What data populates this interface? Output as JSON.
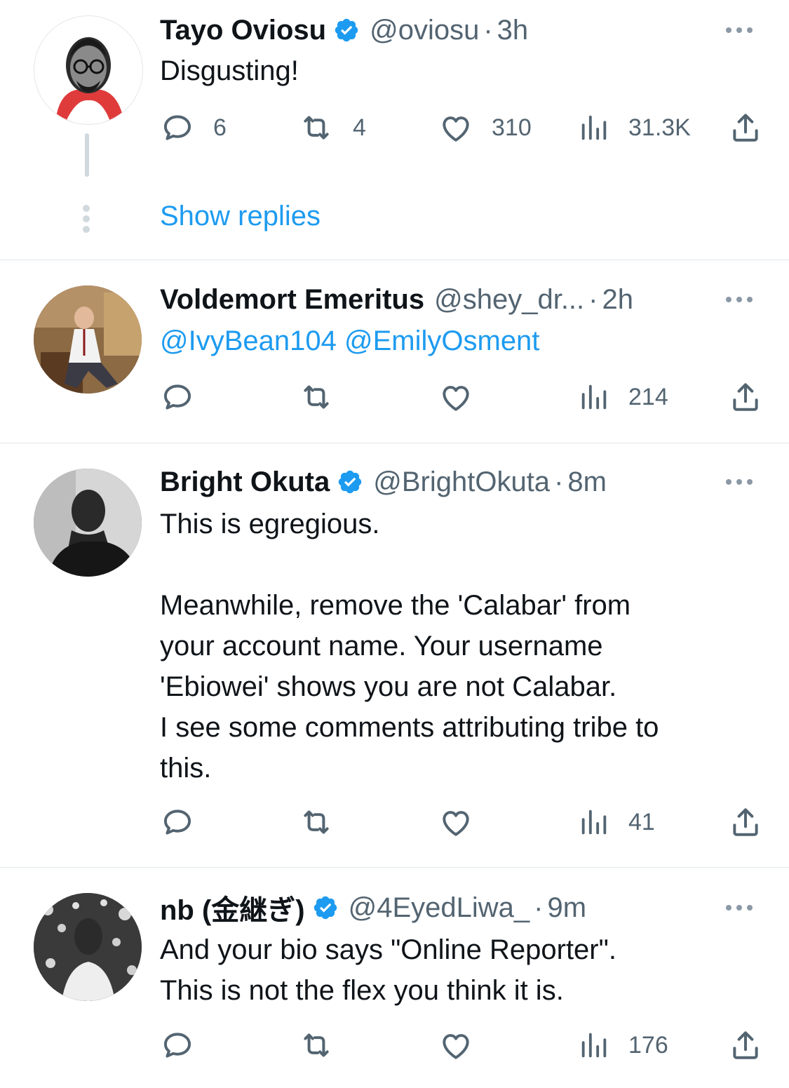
{
  "tweets": [
    {
      "name": "Tayo Oviosu",
      "verified": true,
      "handle": "@oviosu",
      "time": "3h",
      "text": "Disgusting!",
      "replies": "6",
      "retweets": "4",
      "likes": "310",
      "views": "31.3K"
    },
    {
      "name": "Voldemort Emeritus",
      "verified": false,
      "handle": "@shey_dr...",
      "time": "2h",
      "mentions": [
        "@IvyBean104",
        "@EmilyOsment"
      ],
      "replies": "",
      "retweets": "",
      "likes": "",
      "views": "214"
    },
    {
      "name": "Bright Okuta",
      "verified": true,
      "handle": "@BrightOkuta",
      "time": "8m",
      "text_lines": [
        "This is egregious.",
        "",
        "Meanwhile, remove the 'Calabar' from",
        "your account name. Your username",
        "'Ebiowei' shows you are not Calabar.",
        "I see some comments attributing tribe to",
        "this."
      ],
      "replies": "",
      "retweets": "",
      "likes": "",
      "views": "41"
    },
    {
      "name": "nb (金継ぎ)",
      "verified": true,
      "handle": "@4EyedLiwa_",
      "time": "9m",
      "text_lines": [
        "And your bio says \"Online Reporter\".",
        "This is not the flex you think it is."
      ],
      "replies": "",
      "retweets": "",
      "likes": "",
      "views": "176"
    }
  ],
  "thread": {
    "show_replies_label": "Show replies"
  },
  "icons": {
    "verified": "verified-badge-icon",
    "reply": "reply-icon",
    "retweet": "retweet-icon",
    "like": "heart-icon",
    "views": "views-icon",
    "share": "share-icon",
    "more": "more-icon"
  },
  "colors": {
    "accent": "#1d9bf0",
    "secondary": "#536471",
    "text": "#0f1419"
  }
}
